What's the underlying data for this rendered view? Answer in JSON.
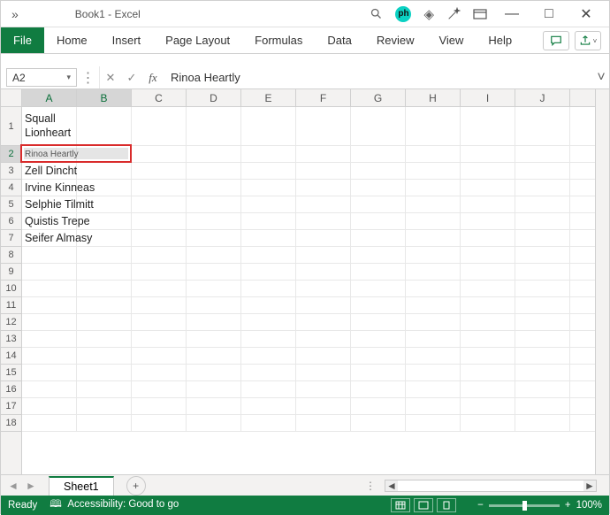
{
  "title": "Book1  -  Excel",
  "ribbon": {
    "file": "File",
    "tabs": [
      "Home",
      "Insert",
      "Page Layout",
      "Formulas",
      "Data",
      "Review",
      "View",
      "Help"
    ]
  },
  "namebox": "A2",
  "formula": "Rinoa Heartly",
  "columns": [
    "A",
    "B",
    "C",
    "D",
    "E",
    "F",
    "G",
    "H",
    "I",
    "J"
  ],
  "row_count": 18,
  "selected_columns": [
    "A",
    "B"
  ],
  "selected_row": 2,
  "tall_row": 1,
  "cells": {
    "A1": "Squall Lionheart",
    "A2": "Rinoa Heartly",
    "A3": "Zell Dincht",
    "A4": "Irvine Kinneas",
    "A5": "Selphie Tilmitt",
    "A6": "Quistis Trepe",
    "A7": "Seifer Almasy"
  },
  "sheet_tab": "Sheet1",
  "status": {
    "ready": "Ready",
    "accessibility": "Accessibility: Good to go",
    "zoom": "100%"
  },
  "icons": {
    "search": "⌕",
    "diamond": "◈",
    "wand": "✎",
    "panel": "▭",
    "min": "—",
    "max": "□",
    "close": "✕",
    "comment": "💬",
    "share": "↗",
    "dropdown": "▾",
    "cancel": "✕",
    "enter": "✓",
    "fx": "fx",
    "expand": "˅",
    "prev": "◄",
    "next": "►",
    "plus": "+",
    "accessibility_icon": "⮌",
    "ph": "ph"
  }
}
